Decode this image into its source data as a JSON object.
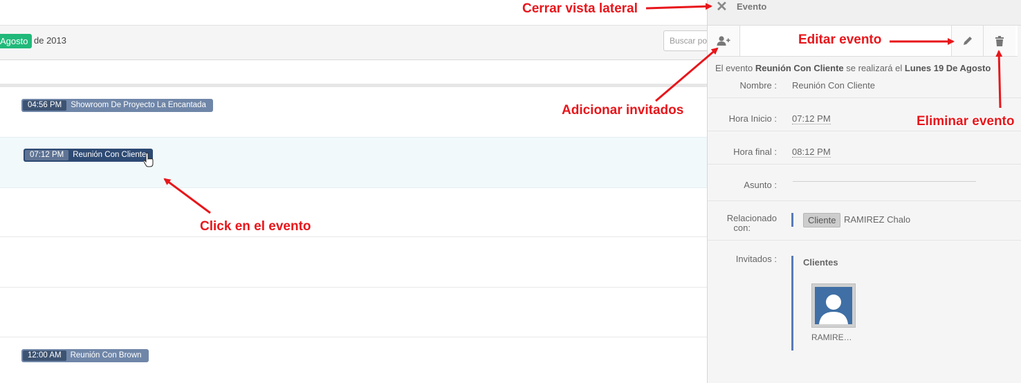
{
  "calendar": {
    "month_label": "Agosto",
    "year_label": "de 2013",
    "search_placeholder": "Buscar po",
    "events": [
      {
        "time": "04:56 PM",
        "title": "Showroom De Proyecto La Encantada"
      },
      {
        "time": "07:12 PM",
        "title": "Reunión Con Cliente"
      },
      {
        "time": "12:00 AM",
        "title": "Reunión Con Brown"
      }
    ]
  },
  "panel": {
    "title": "Evento",
    "close_icon": "close-icon",
    "add_icon": "add-user-icon",
    "edit_icon": "pencil-icon",
    "delete_icon": "trash-icon",
    "summary_prefix": "El evento ",
    "summary_event": "Reunión Con Cliente",
    "summary_middle": " se realizará el ",
    "summary_date": "Lunes 19 De Agosto",
    "fields": {
      "nombre_label": "Nombre :",
      "nombre_value": "Reunión Con Cliente",
      "hora_inicio_label": "Hora Inicio :",
      "hora_inicio_value": "07:12 PM",
      "hora_final_label": "Hora final :",
      "hora_final_value": "08:12 PM",
      "asunto_label": "Asunto :",
      "relacionado_label_1": "Relacionado",
      "relacionado_label_2": "con:",
      "relacionado_tag": "Cliente",
      "relacionado_name": "RAMIREZ Chalo",
      "invitados_label": "Invitados :",
      "clientes_title": "Clientes",
      "invitee_name": "RAMIRE…"
    }
  },
  "annotations": {
    "cerrar": "Cerrar vista lateral",
    "editar": "Editar evento",
    "adicionar": "Adicionar invitados",
    "eliminar": "Eliminar evento",
    "click": "Click en el evento"
  },
  "colors": {
    "annotation": "#e8161b",
    "month_badge": "#20b97a",
    "event_bg": "#6f86a8",
    "event_active_bg": "#2d4a73",
    "accent_bar": "#5b7ab8"
  }
}
